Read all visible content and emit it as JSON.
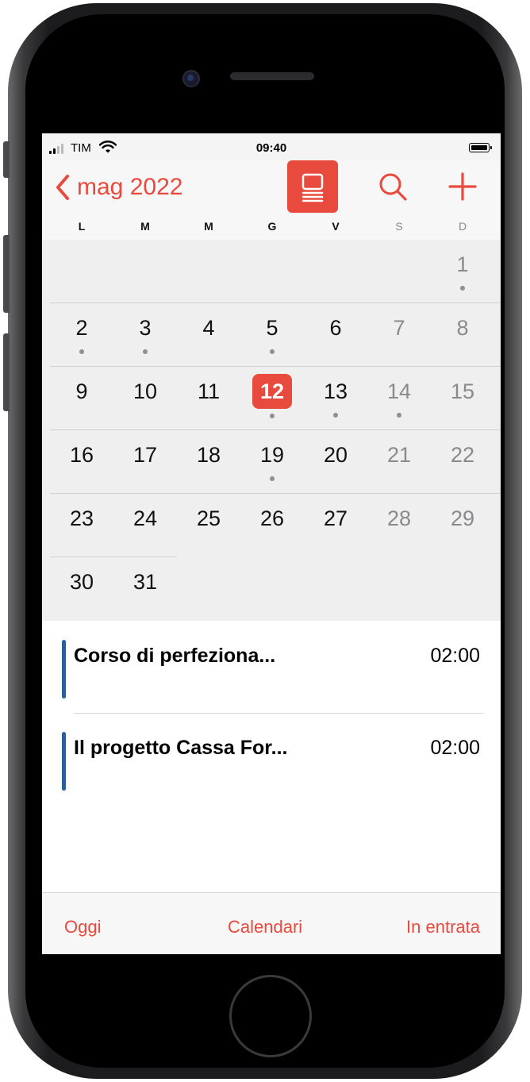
{
  "status_bar": {
    "carrier": "TIM",
    "time": "09:40"
  },
  "header": {
    "back_label": "mag 2022",
    "icons": [
      "chevron-left-icon",
      "list-view-icon",
      "search-icon",
      "add-icon"
    ]
  },
  "weekdays": [
    "L",
    "M",
    "M",
    "G",
    "V",
    "S",
    "D"
  ],
  "calendar": {
    "today": "12",
    "weeks": [
      [
        {
          "n": ""
        },
        {
          "n": ""
        },
        {
          "n": ""
        },
        {
          "n": ""
        },
        {
          "n": ""
        },
        {
          "n": ""
        },
        {
          "n": "1",
          "dot": true
        }
      ],
      [
        {
          "n": "2",
          "dot": true
        },
        {
          "n": "3",
          "dot": true
        },
        {
          "n": "4"
        },
        {
          "n": "5",
          "dot": true
        },
        {
          "n": "6"
        },
        {
          "n": "7"
        },
        {
          "n": "8"
        }
      ],
      [
        {
          "n": "9"
        },
        {
          "n": "10"
        },
        {
          "n": "11"
        },
        {
          "n": "12",
          "dot": true
        },
        {
          "n": "13",
          "dot": true
        },
        {
          "n": "14",
          "dot": true
        },
        {
          "n": "15"
        }
      ],
      [
        {
          "n": "16"
        },
        {
          "n": "17"
        },
        {
          "n": "18"
        },
        {
          "n": "19",
          "dot": true
        },
        {
          "n": "20"
        },
        {
          "n": "21"
        },
        {
          "n": "22"
        }
      ],
      [
        {
          "n": "23"
        },
        {
          "n": "24"
        },
        {
          "n": "25"
        },
        {
          "n": "26"
        },
        {
          "n": "27"
        },
        {
          "n": "28"
        },
        {
          "n": "29"
        }
      ],
      [
        {
          "n": "30"
        },
        {
          "n": "31"
        }
      ]
    ]
  },
  "events": [
    {
      "title": "Corso di perfeziona...",
      "time": "02:00"
    },
    {
      "title": "Il progetto Cassa For...",
      "time": "02:00"
    }
  ],
  "toolbar": {
    "today_label": "Oggi",
    "calendars_label": "Calendari",
    "inbox_label": "In entrata"
  },
  "colors": {
    "accent": "#e84a3d",
    "event_bar": "#2d5f9a",
    "dot": "#8e8e93"
  }
}
